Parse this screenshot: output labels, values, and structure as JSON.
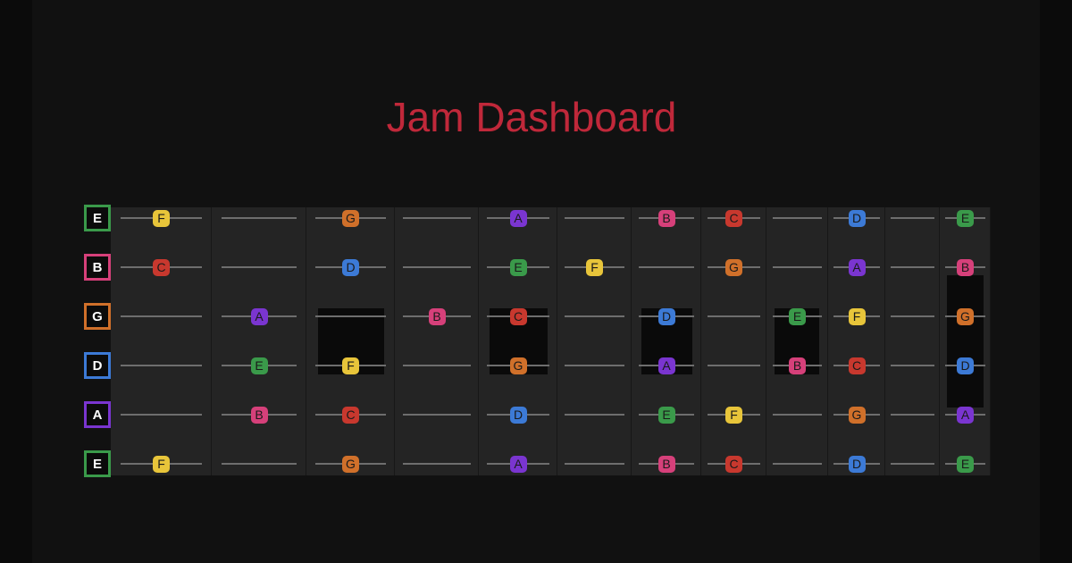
{
  "title": "Jam Dashboard",
  "colors": {
    "title": "#c0283a",
    "background": "#111111",
    "fretboard": "#242424",
    "string_line": "#6e6e6e",
    "notes": {
      "A": "#7a35d0",
      "B": "#d6407a",
      "C": "#c8382e",
      "D": "#3c7ad6",
      "E": "#3a9a4a",
      "F": "#e8c53a",
      "G": "#d0702a"
    }
  },
  "strings": [
    {
      "label": "E",
      "notes": [
        "F",
        "",
        "G",
        "",
        "A",
        "",
        "B",
        "C",
        "",
        "D",
        "",
        "E"
      ]
    },
    {
      "label": "B",
      "notes": [
        "C",
        "",
        "D",
        "",
        "E",
        "F",
        "",
        "G",
        "",
        "A",
        "",
        "B"
      ]
    },
    {
      "label": "G",
      "notes": [
        "",
        "A",
        "",
        "B",
        "C",
        "",
        "D",
        "",
        "E",
        "F",
        "",
        "G"
      ]
    },
    {
      "label": "D",
      "notes": [
        "",
        "E",
        "F",
        "",
        "G",
        "",
        "A",
        "",
        "B",
        "C",
        "",
        "D"
      ]
    },
    {
      "label": "A",
      "notes": [
        "",
        "B",
        "C",
        "",
        "D",
        "",
        "E",
        "F",
        "",
        "G",
        "",
        "A"
      ]
    },
    {
      "label": "E",
      "notes": [
        "F",
        "",
        "G",
        "",
        "A",
        "",
        "B",
        "C",
        "",
        "D",
        "",
        "E"
      ]
    }
  ]
}
